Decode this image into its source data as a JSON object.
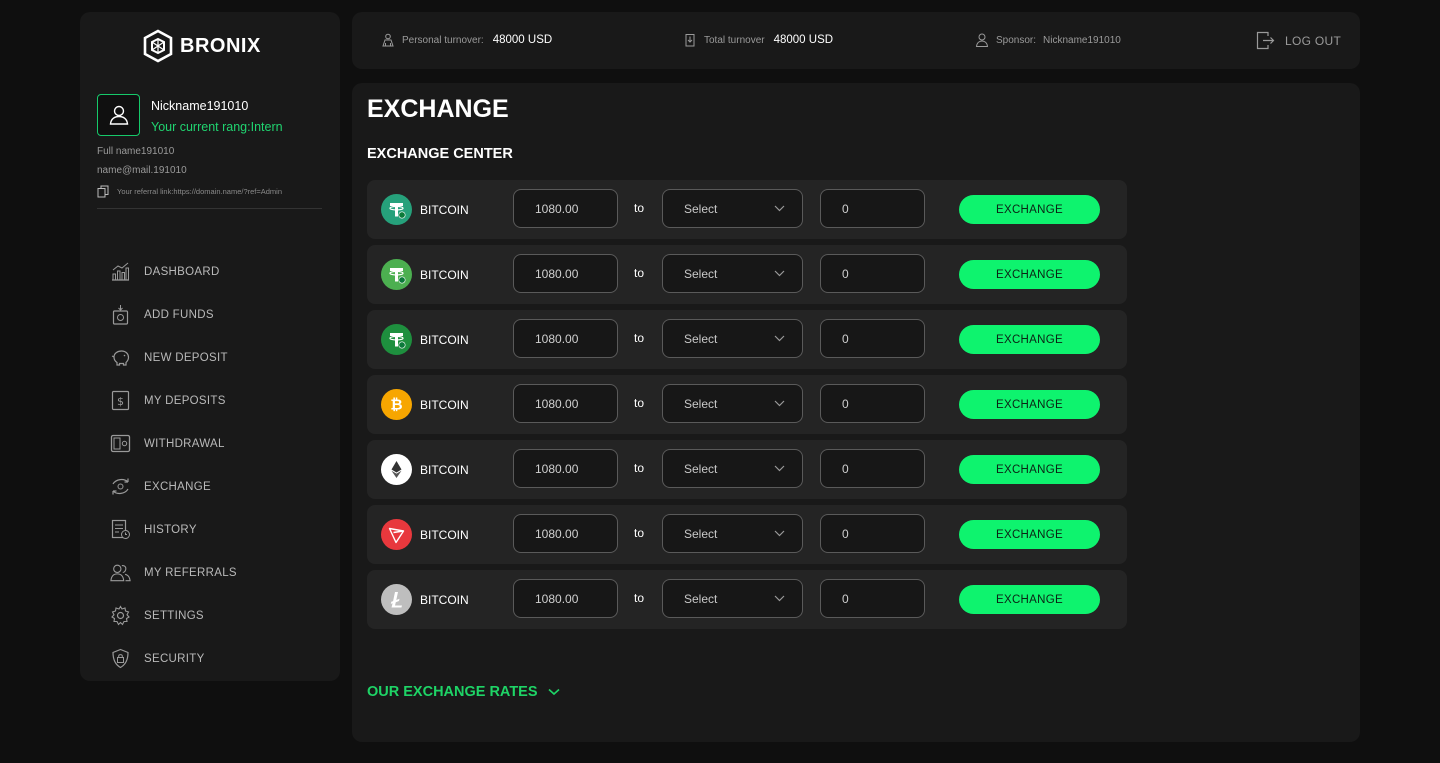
{
  "brand": {
    "name": "BRONIX"
  },
  "profile": {
    "nickname": "Nickname191010",
    "rank": "Your current rang:Intern",
    "full_name": "Full name191010",
    "email": "name@mail.191010",
    "referral": "Your referral link:https://domain.name/?ref=Admin"
  },
  "nav": [
    {
      "label": "DASHBOARD",
      "icon": "chart-icon"
    },
    {
      "label": "ADD FUNDS",
      "icon": "add-funds-icon"
    },
    {
      "label": "NEW DEPOSIT",
      "icon": "piggy-bank-icon"
    },
    {
      "label": "MY DEPOSITS",
      "icon": "dollar-icon"
    },
    {
      "label": "WITHDRAWAL",
      "icon": "wallet-icon"
    },
    {
      "label": "EXCHANGE",
      "icon": "exchange-icon"
    },
    {
      "label": "HISTORY",
      "icon": "history-icon"
    },
    {
      "label": "MY REFERRALS",
      "icon": "referrals-icon"
    },
    {
      "label": "SETTINGS",
      "icon": "gear-icon"
    },
    {
      "label": "SECURITY",
      "icon": "shield-icon"
    }
  ],
  "topbar": {
    "personal_turnover_label": "Personal turnover:",
    "personal_turnover_value": "48000 USD",
    "total_turnover_label": "Total turnover",
    "total_turnover_value": "48000 USD",
    "sponsor_label": "Sponsor:",
    "sponsor_value": "Nickname191010",
    "logout_label": "LOG OUT"
  },
  "page": {
    "title": "EXCHANGE",
    "section_title": "EXCHANGE CENTER",
    "rates_label": "OUR EXCHANGE RATES"
  },
  "exchange_rows": [
    {
      "coin": "BITCOIN",
      "icon": "tether-icon",
      "color": "#26a17b",
      "amount": "1080.00",
      "to": "to",
      "select": "Select",
      "result": "0",
      "button": "EXCHANGE"
    },
    {
      "coin": "BITCOIN",
      "icon": "tether-icon",
      "color": "#4caf50",
      "amount": "1080.00",
      "to": "to",
      "select": "Select",
      "result": "0",
      "button": "EXCHANGE"
    },
    {
      "coin": "BITCOIN",
      "icon": "tether-icon",
      "color": "#1e8f3e",
      "amount": "1080.00",
      "to": "to",
      "select": "Select",
      "result": "0",
      "button": "EXCHANGE"
    },
    {
      "coin": "BITCOIN",
      "icon": "bitcoin-icon",
      "color": "#f7a600",
      "amount": "1080.00",
      "to": "to",
      "select": "Select",
      "result": "0",
      "button": "EXCHANGE"
    },
    {
      "coin": "BITCOIN",
      "icon": "ethereum-icon",
      "color": "#ffffff",
      "amount": "1080.00",
      "to": "to",
      "select": "Select",
      "result": "0",
      "button": "EXCHANGE"
    },
    {
      "coin": "BITCOIN",
      "icon": "tron-icon",
      "color": "#e8383d",
      "amount": "1080.00",
      "to": "to",
      "select": "Select",
      "result": "0",
      "button": "EXCHANGE"
    },
    {
      "coin": "BITCOIN",
      "icon": "litecoin-icon",
      "color": "#bebebe",
      "amount": "1080.00",
      "to": "to",
      "select": "Select",
      "result": "0",
      "button": "EXCHANGE"
    }
  ],
  "colors": {
    "accent": "#0ef36e",
    "accent_text": "#1ed466",
    "panel": "#191919",
    "row": "#242424"
  }
}
